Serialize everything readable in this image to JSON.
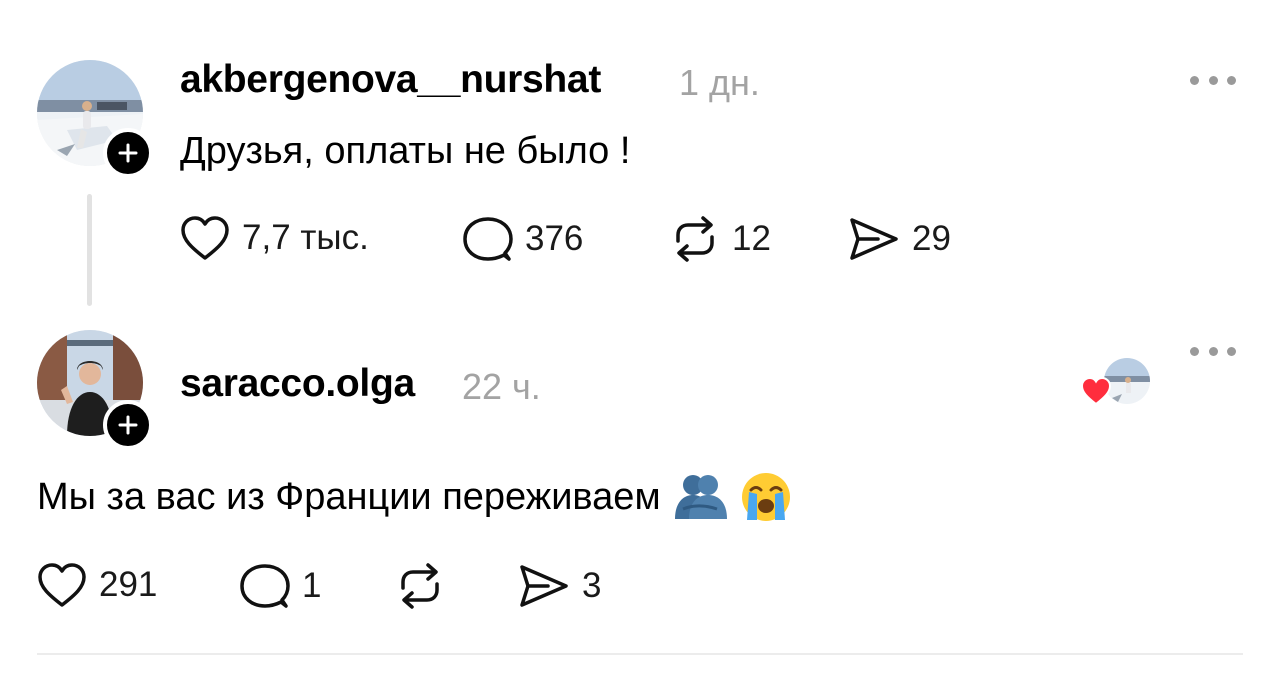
{
  "colors": {
    "text": "#000000",
    "muted": "#a3a3a3",
    "divider": "#ececec",
    "thread_line": "#e2e2e2",
    "heart_red": "#ff2d3d"
  },
  "posts": [
    {
      "username": "akbergenova__nurshat",
      "time": "1 дн.",
      "text": "Друзья, оплаты не было !",
      "actions": {
        "likes": "7,7 тыс.",
        "replies": "376",
        "reposts": "12",
        "shares": "29"
      }
    },
    {
      "username": "saracco.olga",
      "time": "22 ч.",
      "text": "Мы за вас из Франции переживаем",
      "text_emojis": [
        "people-hugging-emoji",
        "loudly-crying-face-emoji"
      ],
      "liked_by_author": true,
      "actions": {
        "likes": "291",
        "replies": "1",
        "reposts": "",
        "shares": "3"
      }
    }
  ],
  "icons": [
    "follow-plus-icon",
    "more-options-icon",
    "heart-icon",
    "reply-icon",
    "repost-icon",
    "share-icon"
  ]
}
